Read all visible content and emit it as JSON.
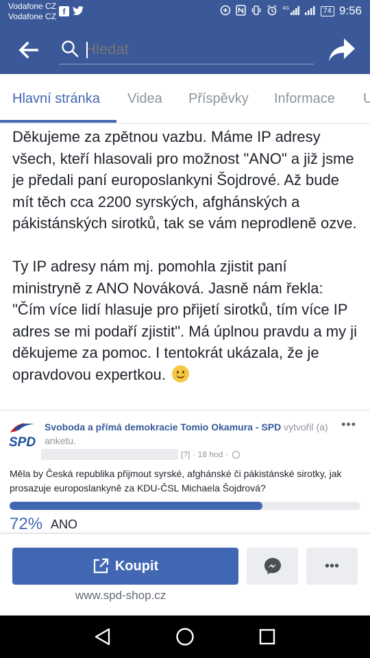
{
  "status_bar": {
    "carrier_1": "Vodafone CZ",
    "carrier_2": "Vodafone CZ",
    "battery": "74",
    "time": "9:56"
  },
  "search": {
    "placeholder": "Hledat"
  },
  "tabs": [
    {
      "label": "Hlavní stránka",
      "active": true
    },
    {
      "label": "Videa"
    },
    {
      "label": "Příspěvky"
    },
    {
      "label": "Informace"
    },
    {
      "label": "U"
    }
  ],
  "post": {
    "paragraph_1": "Děkujeme za zpětnou vazbu. Máme IP adresy všech, kteří hlasovali pro možnost \"ANO\" a již jsme je předali paní europoslankyni Šojdrové. Až bude mít těch cca 2200 syrských, afghánských a pákistánských sirotků, tak se vám neprodleně ozve.",
    "paragraph_2": "Ty IP adresy nám mj. pomohla zjistit paní ministryně z ANO Nováková. Jasně nám řekla: \"Čím více lidí hlasuje pro přijetí sirotků, tím více IP adres se mi podaří zjistit\". Má úplnou pravdu a my ji děkujeme  za pomoc. I tentokrát ukázala, že je opravdovou expertkou."
  },
  "shared_card": {
    "page_name": "Svoboda a přímá demokracie Tomio Okamura - SPD",
    "action": "vytvořil (a) anketu.",
    "meta_tag": "[?]",
    "time_ago": "· 18 hod ·",
    "question": "Měla by Česká republika přijmout syrské, afghánské či pákistánské sirotky, jak prosazuje europoslankyně za KDU-ČSL Michaela Šojdrová?",
    "poll": {
      "percent_label": "72%",
      "percent": 72,
      "option": "ANO"
    },
    "logo_text": "SPD"
  },
  "actions": {
    "buy_label": "Koupit",
    "shop_url": "www.spd-shop.cz"
  },
  "colors": {
    "brand": "#3b5998",
    "accent": "#4267b2"
  }
}
